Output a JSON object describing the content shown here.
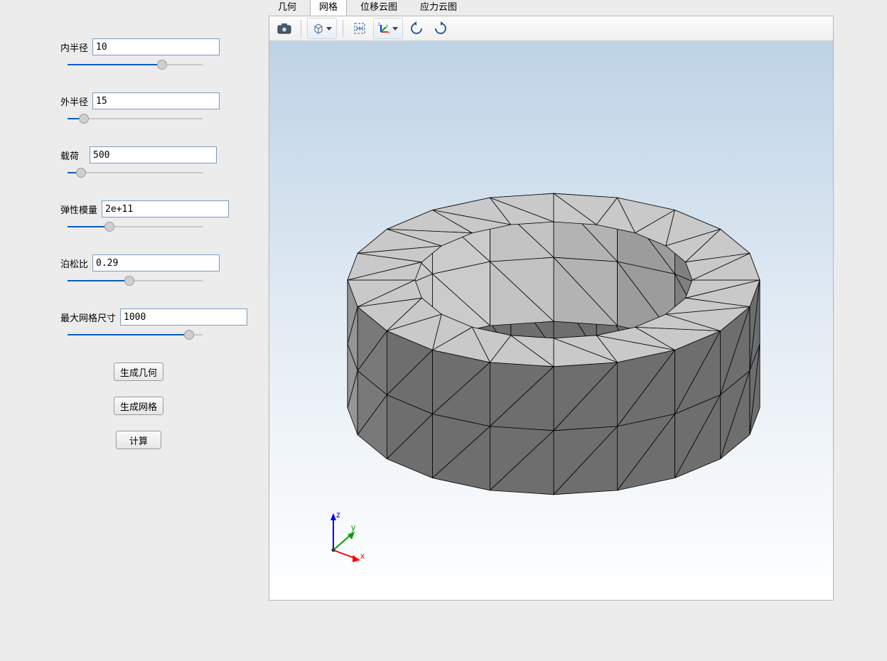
{
  "tabs": {
    "items": [
      {
        "label": "几何",
        "active": false
      },
      {
        "label": "网格",
        "active": true
      },
      {
        "label": "位移云图",
        "active": false
      },
      {
        "label": "应力云图",
        "active": false
      }
    ]
  },
  "params": {
    "inner_radius": {
      "label": "内半径",
      "value": "10",
      "pct": 70
    },
    "outer_radius": {
      "label": "外半径",
      "value": "15",
      "pct": 12
    },
    "load": {
      "label": "载荷",
      "value": "500",
      "pct": 10
    },
    "elastic_mod": {
      "label": "弹性模量",
      "value": "2e+11",
      "pct": 31
    },
    "poisson": {
      "label": "泊松比",
      "value": "0.29",
      "pct": 46
    },
    "max_mesh": {
      "label": "最大网格尺寸",
      "value": "1000",
      "pct": 90
    }
  },
  "buttons": {
    "gen_geometry": "生成几何",
    "gen_mesh": "生成网格",
    "compute": "计算"
  },
  "toolbar": {
    "names": {
      "camera": "camera-icon",
      "cube": "cube-projection-icon",
      "expand": "fit-view-icon",
      "axes": "axes-orientation-icon",
      "rot_ccw": "rotate-ccw-icon",
      "rot_cw": "rotate-cw-icon"
    }
  },
  "axes": {
    "x": "x",
    "y": "y",
    "z": "z"
  }
}
